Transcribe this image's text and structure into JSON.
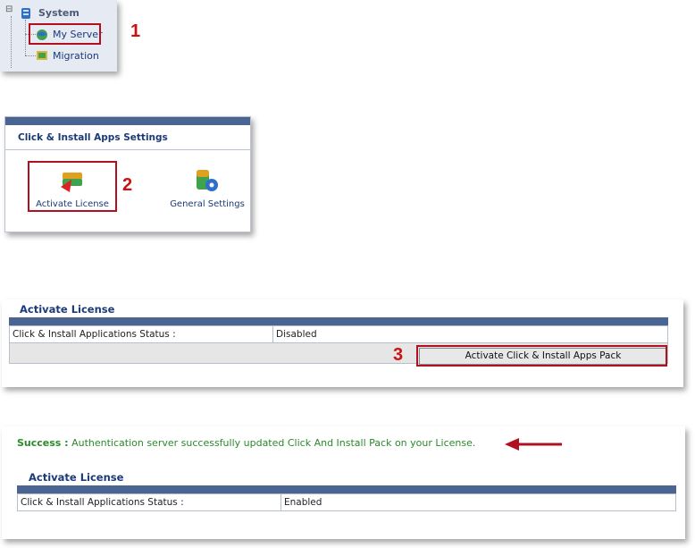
{
  "tree": {
    "root_label": "System",
    "items": [
      {
        "label": "My Server"
      },
      {
        "label": "Migration"
      }
    ],
    "expander": "⊟"
  },
  "callouts": [
    "1",
    "2",
    "3"
  ],
  "apps_settings": {
    "heading": "Click & Install Apps Settings",
    "icons": [
      {
        "label": "Activate License",
        "icon": "license-icon"
      },
      {
        "label": "General Settings",
        "icon": "settings-icon"
      }
    ]
  },
  "activate_before": {
    "title": "Activate License",
    "status_label": "Click & Install Applications Status :",
    "status_value": "Disabled",
    "button_label": "Activate Click & Install Apps Pack"
  },
  "activate_after": {
    "success_prefix": "Success :",
    "success_message": "Authentication server successfully updated Click And Install Pack on your License.",
    "title": "Activate License",
    "status_label": "Click & Install Applications Status :",
    "status_value": "Enabled"
  },
  "colors": {
    "accent_blue": "#1a3a7a",
    "header_bar": "#4a6592",
    "highlight_red": "#b01020",
    "success_green": "#2a8a2a"
  }
}
